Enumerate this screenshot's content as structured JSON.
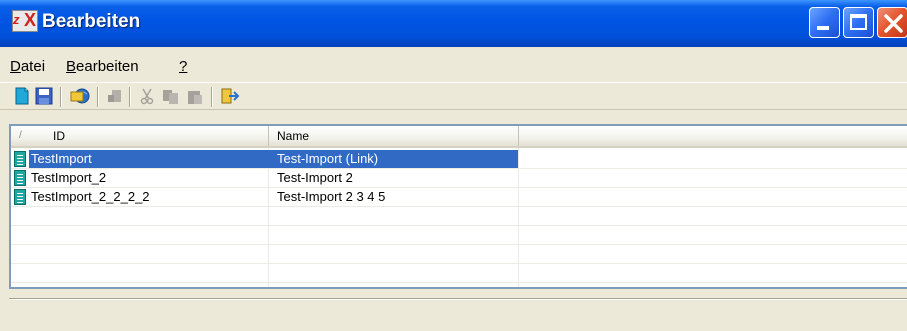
{
  "window": {
    "title": "Bearbeiten",
    "app_icon": "ax-app-icon"
  },
  "window_controls": [
    "minimize-icon",
    "maximize-icon",
    "close-icon"
  ],
  "menu": [
    {
      "label": "Datei",
      "accel": "D"
    },
    {
      "label": "Bearbeiten",
      "accel": "B"
    },
    {
      "label": "?",
      "accel": "?"
    }
  ],
  "toolbar": [
    "new-document-icon",
    "save-icon",
    "import-icon",
    "disabled-icon",
    "cut-icon",
    "copy-icon",
    "paste-icon",
    "exit-icon"
  ],
  "table": {
    "sort_indicator": "/",
    "columns": [
      "ID",
      "Name"
    ],
    "rows": [
      {
        "id": "TestImport",
        "name": "Test-Import (Link)",
        "selected": true
      },
      {
        "id": "TestImport_2",
        "name": "Test-Import 2",
        "selected": false
      },
      {
        "id": "TestImport_2_2_2_2",
        "name": "Test-Import 2 3 4 5",
        "selected": false
      }
    ]
  },
  "colors": {
    "title_blue": "#0054e3",
    "selection": "#316ac5",
    "window_bg": "#ece9d8"
  }
}
